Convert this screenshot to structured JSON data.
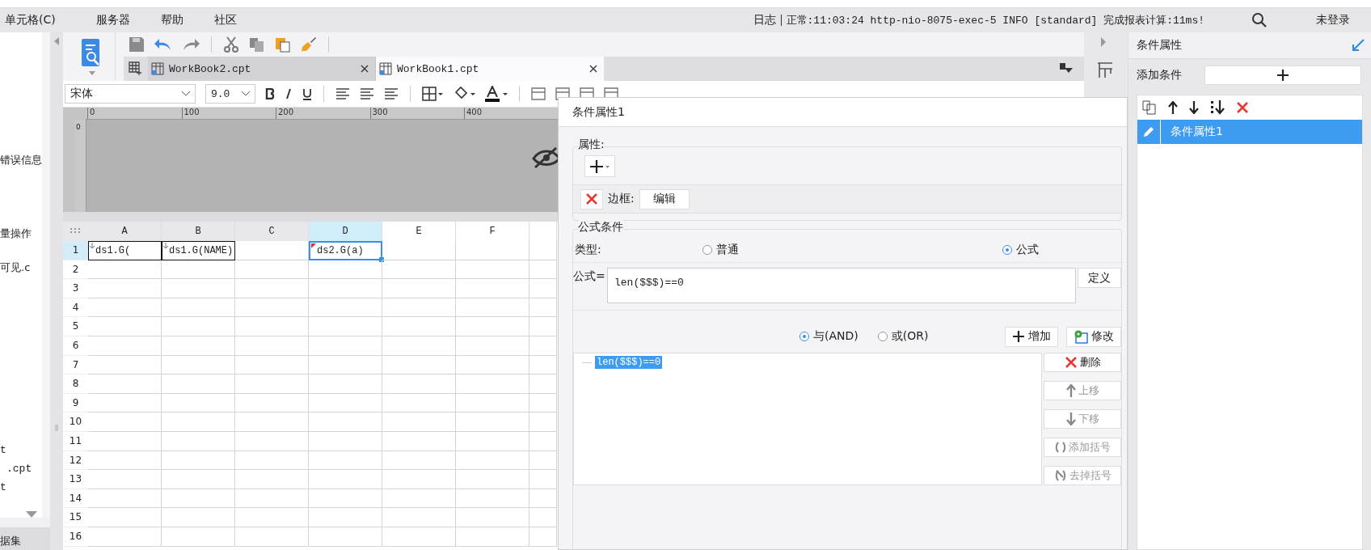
{
  "menu": [
    {
      "label": "单元格(C)"
    },
    {
      "label": "服务器"
    },
    {
      "label": "帮助"
    },
    {
      "label": "社区"
    }
  ],
  "log": {
    "label": "日志",
    "message": "正常:11:03:24 http-nio-8075-exec-5 INFO [standard] 完成报表计算:11ms!"
  },
  "user": "未登录",
  "left_panel": {
    "items": [
      "错误信息",
      "量操作",
      "可见.c",
      "t",
      ".cpt",
      "t"
    ],
    "footer": "据集"
  },
  "tabs": [
    {
      "label": "WorkBook2.cpt",
      "selected": false
    },
    {
      "label": "WorkBook1.cpt",
      "selected": true
    }
  ],
  "format_toolbar": {
    "font": "宋体",
    "size": "9.0"
  },
  "ruler": {
    "ticks": [
      "0",
      "100",
      "200",
      "300",
      "400"
    ],
    "left_tick": "0"
  },
  "sheet": {
    "columns": [
      {
        "label": "A",
        "selected": false
      },
      {
        "label": "B",
        "selected": false
      },
      {
        "label": "C",
        "selected": false
      },
      {
        "label": "D",
        "selected": true
      },
      {
        "label": "E",
        "selected": false
      },
      {
        "label": "F",
        "selected": false
      }
    ],
    "rows": [
      {
        "label": "1",
        "selected": true,
        "cells": [
          {
            "kind": "text",
            "text": "ds1.G(",
            "bordered": true,
            "selected": false,
            "expandable": true,
            "flagged": false
          },
          {
            "kind": "text",
            "text": "ds1.G(NAME)",
            "bordered": true,
            "selected": false,
            "expandable": true,
            "flagged": false
          },
          {
            "kind": "empty"
          },
          {
            "kind": "text",
            "text": "ds2.G(a)",
            "bordered": false,
            "selected": true,
            "expandable": false,
            "flagged": true
          }
        ]
      },
      {
        "label": "2",
        "selected": false
      },
      {
        "label": "3",
        "selected": false
      },
      {
        "label": "4",
        "selected": false
      },
      {
        "label": "5",
        "selected": false
      },
      {
        "label": "6",
        "selected": false
      },
      {
        "label": "7",
        "selected": false
      },
      {
        "label": "8",
        "selected": false
      },
      {
        "label": "9",
        "selected": false
      },
      {
        "label": "10",
        "selected": false
      },
      {
        "label": "11",
        "selected": false
      },
      {
        "label": "12",
        "selected": false
      },
      {
        "label": "13",
        "selected": false
      },
      {
        "label": "14",
        "selected": false
      },
      {
        "label": "15",
        "selected": false
      },
      {
        "label": "16",
        "selected": false
      }
    ]
  },
  "dialog": {
    "title": "条件属性1",
    "attributes": {
      "legend": "属性:",
      "items": [
        {
          "label": "边框:",
          "button": "编辑"
        }
      ]
    },
    "formula_condition": {
      "legend": "公式条件",
      "type_label": "类型:",
      "types": [
        {
          "label": "普通",
          "selected": false
        },
        {
          "label": "公式",
          "selected": true
        }
      ],
      "formula_label": "公式=",
      "formula": "len($$$)==0",
      "define_button": "定义",
      "logic": [
        {
          "label": "与(AND)",
          "selected": true
        },
        {
          "label": "或(OR)",
          "selected": false
        }
      ],
      "add_button": "增加",
      "modify_button": "修改",
      "conditions": [
        {
          "text": "len($$$)==0",
          "selected": true
        }
      ],
      "actions": [
        {
          "label": "删除",
          "kind": "delete",
          "disabled": false
        },
        {
          "label": "上移",
          "kind": "up",
          "disabled": true
        },
        {
          "label": "下移",
          "kind": "down",
          "disabled": true
        },
        {
          "label": "添加括号",
          "kind": "paren",
          "disabled": true
        },
        {
          "label": "去掉括号",
          "kind": "unparen",
          "disabled": true
        }
      ]
    }
  },
  "right_panel": {
    "title": "条件属性",
    "add_label": "添加条件",
    "list": [
      {
        "label": "条件属性1",
        "selected": true
      }
    ]
  }
}
